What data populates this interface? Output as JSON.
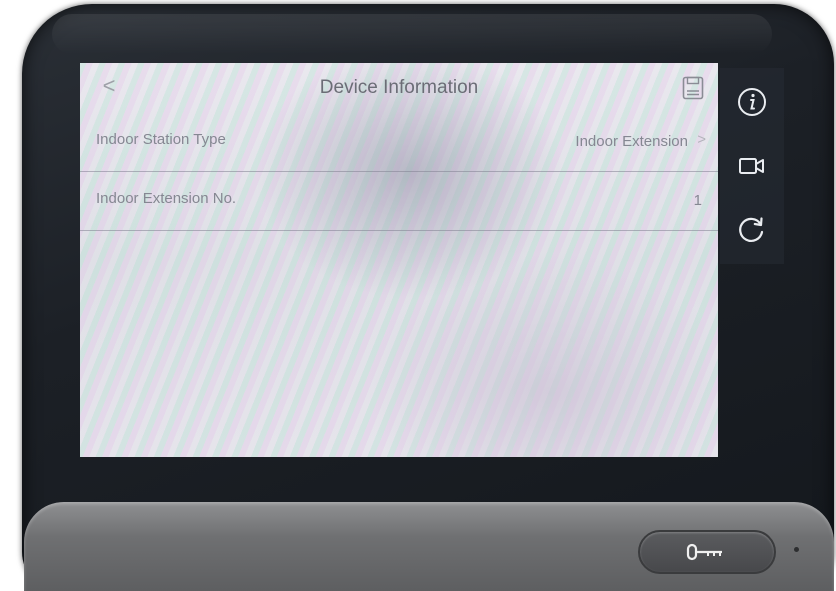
{
  "screen": {
    "title": "Device Information",
    "back_label": "<",
    "rows": [
      {
        "label": "Indoor Station Type",
        "value": "Indoor Extension",
        "chevron": ">"
      },
      {
        "label": "Indoor Extension No.",
        "value": "1"
      }
    ]
  },
  "header_icons": {
    "save": "save-icon"
  },
  "side_buttons": [
    {
      "icon": "info-icon"
    },
    {
      "icon": "camera-icon"
    },
    {
      "icon": "refresh-icon"
    }
  ],
  "hardware": {
    "unlock_button_icon": "key-icon"
  }
}
